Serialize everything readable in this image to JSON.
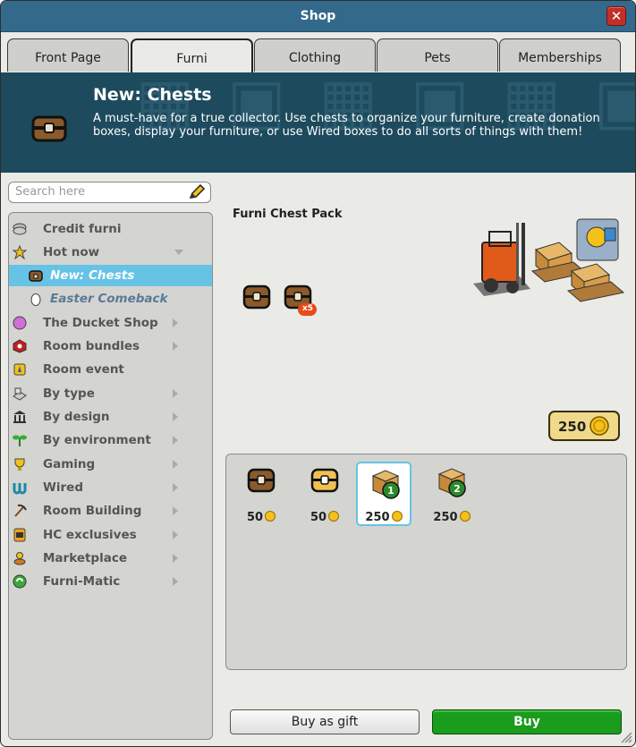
{
  "window": {
    "title": "Shop"
  },
  "tabs": [
    {
      "label": "Front Page",
      "active": false
    },
    {
      "label": "Furni",
      "active": true
    },
    {
      "label": "Clothing",
      "active": false
    },
    {
      "label": "Pets",
      "active": false
    },
    {
      "label": "Memberships",
      "active": false
    }
  ],
  "banner": {
    "title": "New: Chests",
    "text": "A must-have for a true collector. Use chests to organize your furniture, create donation boxes, display your furniture, or use Wired boxes to do all sorts of things with them!",
    "icon": "chest-icon"
  },
  "search": {
    "placeholder": "Search here",
    "icon": "pencil-icon"
  },
  "nav": {
    "items": [
      {
        "label": "Credit furni",
        "icon": "credit-icon",
        "has_children": false,
        "selected": false,
        "sub": false
      },
      {
        "label": "Hot now",
        "icon": "star-icon",
        "has_children": true,
        "expanded": true,
        "selected": false,
        "sub": false
      },
      {
        "label": "New: Chests",
        "icon": "chest-icon",
        "has_children": false,
        "selected": true,
        "sub": true
      },
      {
        "label": "Easter Comeback",
        "icon": "egg-icon",
        "has_children": false,
        "selected": false,
        "sub": true
      },
      {
        "label": "The Ducket Shop",
        "icon": "ducket-icon",
        "has_children": true,
        "selected": false,
        "sub": false
      },
      {
        "label": "Room bundles",
        "icon": "bundle-icon",
        "has_children": true,
        "selected": false,
        "sub": false
      },
      {
        "label": "Room event",
        "icon": "event-icon",
        "has_children": false,
        "selected": false,
        "sub": false
      },
      {
        "label": "By type",
        "icon": "type-icon",
        "has_children": true,
        "selected": false,
        "sub": false
      },
      {
        "label": "By design",
        "icon": "design-icon",
        "has_children": true,
        "selected": false,
        "sub": false
      },
      {
        "label": "By environment",
        "icon": "plant-icon",
        "has_children": true,
        "selected": false,
        "sub": false
      },
      {
        "label": "Gaming",
        "icon": "trophy-icon",
        "has_children": true,
        "selected": false,
        "sub": false
      },
      {
        "label": "Wired",
        "icon": "wired-icon",
        "has_children": true,
        "selected": false,
        "sub": false
      },
      {
        "label": "Room Building",
        "icon": "pickaxe-icon",
        "has_children": true,
        "selected": false,
        "sub": false
      },
      {
        "label": "HC exclusives",
        "icon": "hc-icon",
        "has_children": true,
        "selected": false,
        "sub": false
      },
      {
        "label": "Marketplace",
        "icon": "marketplace-icon",
        "has_children": true,
        "selected": false,
        "sub": false
      },
      {
        "label": "Furni-Matic",
        "icon": "recycle-icon",
        "has_children": true,
        "selected": false,
        "sub": false
      }
    ]
  },
  "product": {
    "title": "Furni Chest Pack",
    "price": "250",
    "badge": "x5"
  },
  "offers": [
    {
      "icon": "chest-brown-icon",
      "price": "50",
      "selected": false
    },
    {
      "icon": "chest-gold-icon",
      "price": "50",
      "selected": false
    },
    {
      "icon": "box-green-1-icon",
      "price": "250",
      "selected": true
    },
    {
      "icon": "box-green-2-icon",
      "price": "250",
      "selected": false
    }
  ],
  "buttons": {
    "gift": "Buy as gift",
    "buy": "Buy"
  },
  "colors": {
    "titlebar": "#336a8b",
    "banner": "#1d4a5c",
    "selected": "#66c3e6",
    "buy": "#1a9c1c",
    "close": "#c0302a",
    "coin": "#f2c21a"
  }
}
